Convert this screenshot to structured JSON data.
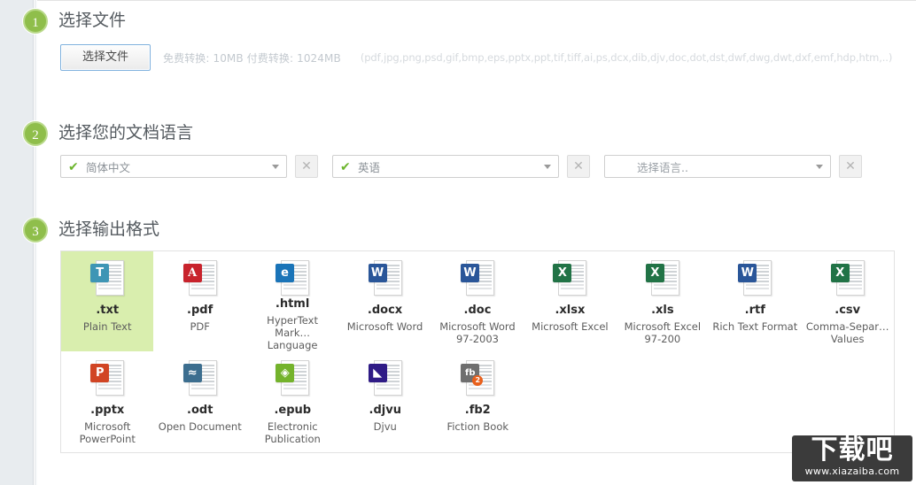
{
  "steps": {
    "one": {
      "number": "1",
      "title": "选择文件"
    },
    "two": {
      "number": "2",
      "title": "选择您的文档语言"
    },
    "three": {
      "number": "3",
      "title": "选择输出格式"
    }
  },
  "upload": {
    "choose_button": "选择文件",
    "size_note": "免费转换: 10MB  付费转换: 1024MB",
    "ext_note": "(pdf,jpg,png,psd,gif,bmp,eps,pptx,ppt,tif,tiff,ai,ps,dcx,dib,djv,doc,dot,dst,dwf,dwg,dwt,dxf,emf,hdp,htm,..)"
  },
  "languages": {
    "clear_label": "✕",
    "selects": [
      {
        "value": "简体中文",
        "checked": true,
        "is_placeholder": false
      },
      {
        "value": "英语",
        "checked": true,
        "is_placeholder": false
      },
      {
        "value": "选择语言..",
        "checked": false,
        "is_placeholder": true
      }
    ]
  },
  "formats": {
    "selected": ".txt",
    "rows": [
      [
        {
          "ext": ".txt",
          "desc": "Plain Text",
          "tag": "T",
          "color": "#3e95b5",
          "selected": true,
          "badge": ""
        },
        {
          "ext": ".pdf",
          "desc": "PDF",
          "tag": "A",
          "color": "#c8232c",
          "selected": false,
          "badge": ""
        },
        {
          "ext": ".html",
          "desc": "HyperText Mark… Language",
          "tag": "e",
          "color": "#1a74b8",
          "selected": false,
          "badge": ""
        },
        {
          "ext": ".docx",
          "desc": "Microsoft Word",
          "tag": "W",
          "color": "#2a5699",
          "selected": false,
          "badge": ""
        },
        {
          "ext": ".doc",
          "desc": "Microsoft Word 97-2003",
          "tag": "W",
          "color": "#2a5699",
          "selected": false,
          "badge": ""
        },
        {
          "ext": ".xlsx",
          "desc": "Microsoft Excel",
          "tag": "X",
          "color": "#217346",
          "selected": false,
          "badge": ""
        },
        {
          "ext": ".xls",
          "desc": "Microsoft Excel 97-200",
          "tag": "X",
          "color": "#217346",
          "selected": false,
          "badge": ""
        },
        {
          "ext": ".rtf",
          "desc": "Rich Text Format",
          "tag": "W",
          "color": "#2a5699",
          "selected": false,
          "badge": ""
        },
        {
          "ext": ".csv",
          "desc": "Comma-Separ… Values",
          "tag": "X",
          "color": "#217346",
          "selected": false,
          "badge": ""
        }
      ],
      [
        {
          "ext": ".pptx",
          "desc": "Microsoft PowerPoint",
          "tag": "P",
          "color": "#d14524",
          "selected": false,
          "badge": ""
        },
        {
          "ext": ".odt",
          "desc": "Open Document",
          "tag": "≈",
          "color": "#3c6e8f",
          "selected": false,
          "badge": ""
        },
        {
          "ext": ".epub",
          "desc": "Electronic Publication",
          "tag": "◈",
          "color": "#74b32c",
          "selected": false,
          "badge": ""
        },
        {
          "ext": ".djvu",
          "desc": "Djvu",
          "tag": "◣",
          "color": "#2f1b86",
          "selected": false,
          "badge": ""
        },
        {
          "ext": ".fb2",
          "desc": "Fiction Book",
          "tag": "fb",
          "color": "#6f6f6f",
          "selected": false,
          "badge": "2"
        }
      ]
    ]
  },
  "watermark": {
    "main": "下载吧",
    "sub": "www.xiazaiba.com"
  }
}
